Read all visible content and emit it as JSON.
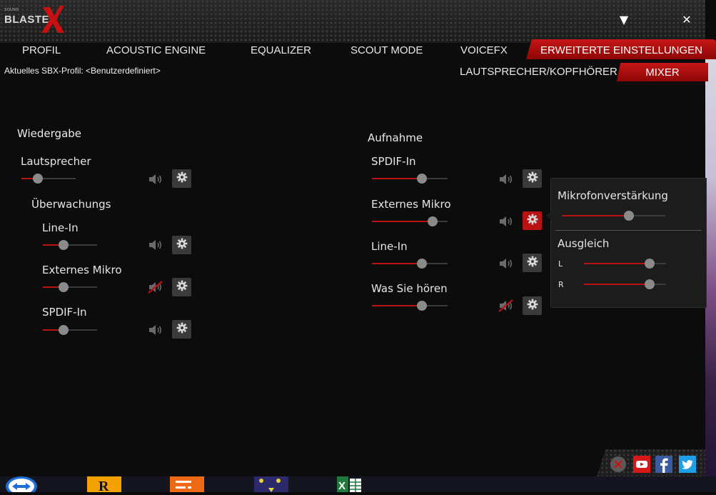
{
  "window": {
    "logo_small": "SOUND",
    "logo_brand": "BLASTER",
    "minimize_glyph": "▼",
    "close_glyph": "✕"
  },
  "tabs": [
    {
      "label": "PROFIL",
      "active": false
    },
    {
      "label": "ACOUSTIC ENGINE",
      "active": false
    },
    {
      "label": "EQUALIZER",
      "active": false
    },
    {
      "label": "SCOUT MODE",
      "active": false
    },
    {
      "label": "VOICEFX",
      "active": false
    },
    {
      "label": "ERWEITERTE EINSTELLUNGEN",
      "active": true
    }
  ],
  "profile_line": "Aktuelles SBX-Profil: <Benutzerdefiniert>",
  "subtabs": {
    "speaker": "LAUTSPRECHER/KOPFHÖRER",
    "mixer": "MIXER",
    "active": "mixer"
  },
  "playback": {
    "title": "Wiedergabe",
    "master": {
      "label": "Lautsprecher",
      "level": 0.3,
      "muted": false
    },
    "monitor_title": "Überwachungs",
    "channels": [
      {
        "label": "Line-In",
        "level": 0.38,
        "muted": false
      },
      {
        "label": "Externes Mikro",
        "level": 0.38,
        "muted": true
      },
      {
        "label": "SPDIF-In",
        "level": 0.38,
        "muted": false
      }
    ]
  },
  "recording": {
    "title": "Aufnahme",
    "channels": [
      {
        "label": "SPDIF-In",
        "level": 0.66,
        "muted": false,
        "settings_open": false
      },
      {
        "label": "Externes Mikro",
        "level": 0.8,
        "muted": false,
        "settings_open": true
      },
      {
        "label": "Line-In",
        "level": 0.66,
        "muted": false,
        "settings_open": false
      },
      {
        "label": "Was Sie hören",
        "level": 0.66,
        "muted": true,
        "settings_open": false
      }
    ]
  },
  "popup": {
    "gain_title": "Mikrofonverstärkung",
    "gain_level": 0.65,
    "balance_title": "Ausgleich",
    "left_label": "L",
    "right_label": "R",
    "left_level": 0.8,
    "right_level": 0.8
  },
  "social": [
    "close-icon",
    "youtube-icon",
    "facebook-icon",
    "twitter-icon"
  ],
  "colors": {
    "accent": "#b81212",
    "background": "#0c0c0c",
    "text": "#e6e6e6"
  }
}
